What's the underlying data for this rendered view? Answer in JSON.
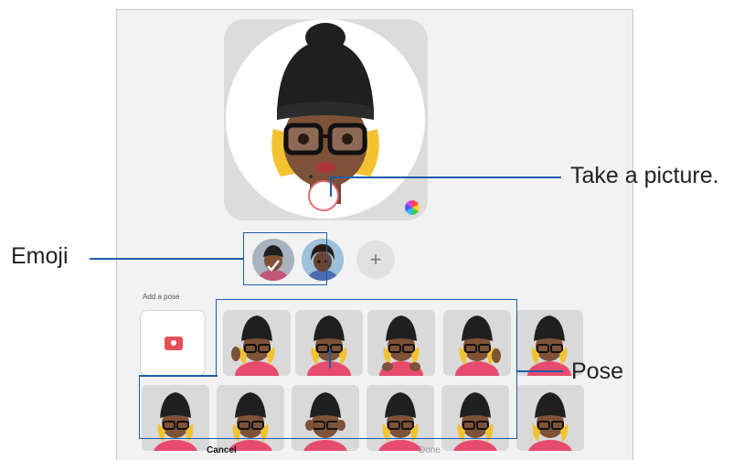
{
  "screen": {
    "add_pose_label": "Add a pose",
    "cancel_label": "Cancel",
    "done_label": "Done"
  },
  "callouts": {
    "emoji": "Emoji",
    "take_picture": "Take a picture.",
    "pose": "Pose"
  },
  "emoji_list": {
    "add_symbol": "+"
  },
  "colors": {
    "shutter_ring": "#e36a6f",
    "camera_icon": "#e5505a",
    "callout_line": "#1e5da8",
    "done_disabled": "#9a9a9a"
  },
  "icons": [
    "shutter-button",
    "color-palette-icon",
    "camera-icon",
    "add-icon"
  ]
}
